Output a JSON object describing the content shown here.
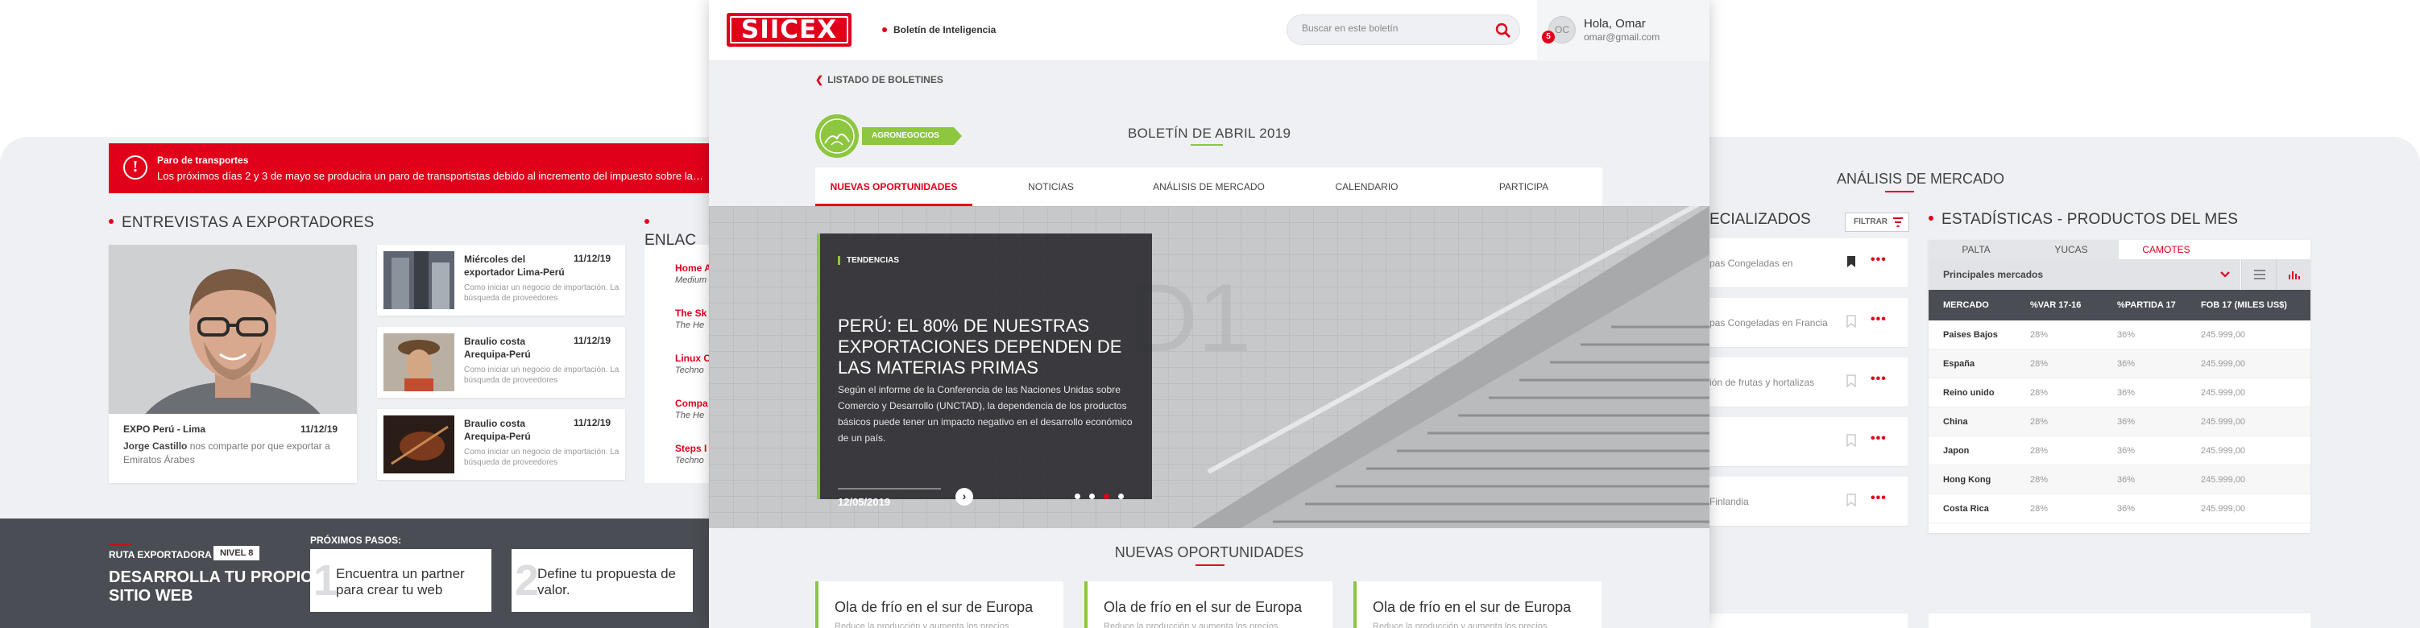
{
  "left": {
    "alert": {
      "title": "Paro de transportes",
      "text": "Los próximos días 2 y 3 de mayo se producira un paro de transportistas debido al incremento del impuesto sobre la gasolina"
    },
    "entrevistas_title": "ENTREVISTAS A EXPORTADORES",
    "enlaces_title": "ENLAC",
    "feature": {
      "place": "EXPO Perú - Lima",
      "date": "11/12/19",
      "author": "Jorge Castillo",
      "desc_rest": " nos comparte por que exportar a Emiratos Árabes"
    },
    "list": [
      {
        "name": "Miércoles del exportador Lima-Perú",
        "date": "11/12/19",
        "desc": "Como iniciar un negocio de importación. La búsqueda de proveedores"
      },
      {
        "name": "Braulio costa Arequipa-Perú",
        "date": "11/12/19",
        "desc": "Como iniciar un negocio de importación. La búsqueda de proveedores"
      },
      {
        "name": "Braulio costa Arequipa-Perú",
        "date": "11/12/19",
        "desc": "Como iniciar un negocio de importación. La búsqueda de proveedores"
      }
    ],
    "links": [
      {
        "title": "Home A",
        "sub": "Medium"
      },
      {
        "title": "The Sk",
        "sub": "The He"
      },
      {
        "title": "Linux C",
        "sub": "Techno"
      },
      {
        "title": "Compa",
        "sub": "The He"
      },
      {
        "title": "Steps I",
        "sub": "Techno"
      }
    ],
    "ruta": {
      "label": "RUTA EXPORTADORA",
      "nivel": "NIVEL 8",
      "title": "DESARROLLA TU PROPIO SITIO WEB",
      "proximos": "PRÓXIMOS PASOS:",
      "steps": [
        {
          "n": "1",
          "text": "Encuentra un partner para crear tu web"
        },
        {
          "n": "2",
          "text": "Define tu propuesta de valor."
        }
      ]
    }
  },
  "center": {
    "logo": "SIICEX",
    "boletin_label": "Boletín de Inteligencia",
    "search_placeholder": "Buscar en este boletín",
    "user": {
      "initials": "OC",
      "badge": "5",
      "greeting": "Hola, Omar",
      "email": "omar@gmail.com"
    },
    "breadcrumb": "LISTADO DE BOLETINES",
    "category": "AGRONEGOCIOS",
    "title": "BOLETÍN DE ABRIL 2019",
    "tabs": [
      "NUEVAS OPORTUNIDADES",
      "NOTICIAS",
      "ANÁLISIS DE MERCADO",
      "CALENDARIO",
      "PARTICIPA"
    ],
    "active_tab": 0,
    "hero": {
      "tag": "TENDENCIAS",
      "title": "PERÚ: EL 80% DE NUESTRAS EXPORTACIONES DEPENDEN DE LAS MATERIAS PRIMAS",
      "body": "Según el informe de la Conferencia de las Naciones Unidas sobre Comercio y Desarrollo (UNCTAD), la dependencia de los productos básicos puede tener un impacto negativo en el desarrollo económico de un país.",
      "date": "12/05/2019",
      "slides": 4,
      "active_slide": 2
    },
    "nuevas_title": "NUEVAS OPORTUNIDADES",
    "cards": [
      {
        "title": "Ola de frío en el sur de Europa",
        "text": "Reduce la producción y aumenta los precios"
      },
      {
        "title": "Ola de frío en el sur de Europa",
        "text": "Reduce la producción y aumenta los precios"
      },
      {
        "title": "Ola de frío en el sur de Europa",
        "text": "Reduce la producción y aumenta los precios"
      }
    ]
  },
  "right": {
    "analisis_title": "ANÁLISIS DE MERCADO",
    "especializados_title": "ECIALIZADOS",
    "filtrar": "FILTRAR",
    "rows": [
      {
        "text": "pas Congeladas en",
        "bookmarked": true
      },
      {
        "text": "pas Congeladas en Francia",
        "bookmarked": false
      },
      {
        "text": "ión de frutas y hortalizas",
        "bookmarked": false
      },
      {
        "text": "",
        "bookmarked": false
      },
      {
        "text": "Finlandia",
        "bookmarked": false
      }
    ],
    "more_label": "•••",
    "estadisticas_title": "ESTADÍSTICAS - PRODUCTOS DEL MES",
    "product_tabs": [
      "PALTA",
      "YUCAS",
      "CAMOTES"
    ],
    "active_product": 2,
    "mercados_label": "Principales mercados",
    "table_headers": [
      "MERCADO",
      "%VAR 17-16",
      "%PARTIDA 17",
      "FOB 17 (MILES US$)"
    ],
    "table_rows": [
      [
        "Paises Bajos",
        "28%",
        "36%",
        "245.999,00"
      ],
      [
        "España",
        "28%",
        "36%",
        "245.999,00"
      ],
      [
        "Reino unido",
        "28%",
        "36%",
        "245.999,00"
      ],
      [
        "China",
        "28%",
        "36%",
        "245.999,00"
      ],
      [
        "Japon",
        "28%",
        "36%",
        "245.999,00"
      ],
      [
        "Hong Kong",
        "28%",
        "36%",
        "245.999,00"
      ],
      [
        "Costa Rica",
        "28%",
        "36%",
        "245.999,00"
      ]
    ]
  },
  "colors": {
    "brand_red": "#e1001a",
    "accent_green": "#8dc63f",
    "dark": "#4a4d53",
    "panel_bg": "#eef0f3"
  }
}
